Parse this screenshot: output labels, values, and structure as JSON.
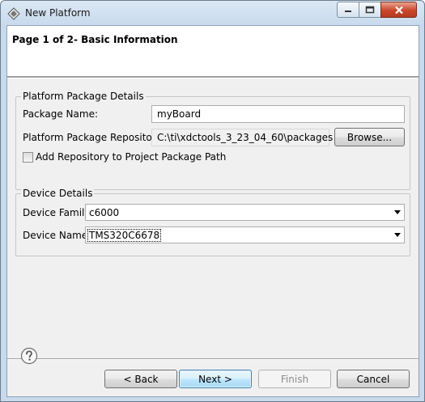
{
  "window": {
    "title": "New Platform",
    "controls": {
      "minimize": "minimize",
      "maximize": "maximize",
      "close": "close"
    }
  },
  "banner": {
    "title": "Page 1 of 2- Basic Information"
  },
  "platform_package": {
    "group_label": "Platform Package Details",
    "package_name_label": "Package Name:",
    "package_name_value": "myBoard",
    "repository_label": "Platform Package Repository:",
    "repository_value": "C:\\ti\\xdctools_3_23_04_60\\packages",
    "browse_label": "Browse...",
    "add_repo_label": "Add Repository to Project Package Path",
    "add_repo_checked": false
  },
  "device": {
    "group_label": "Device Details",
    "family_label": "Device Family",
    "family_value": "c6000",
    "name_label": "Device Name",
    "name_value": "TMS320C6678"
  },
  "footer": {
    "back_label": "< Back",
    "next_label": "Next >",
    "finish_label": "Finish",
    "cancel_label": "Cancel"
  }
}
